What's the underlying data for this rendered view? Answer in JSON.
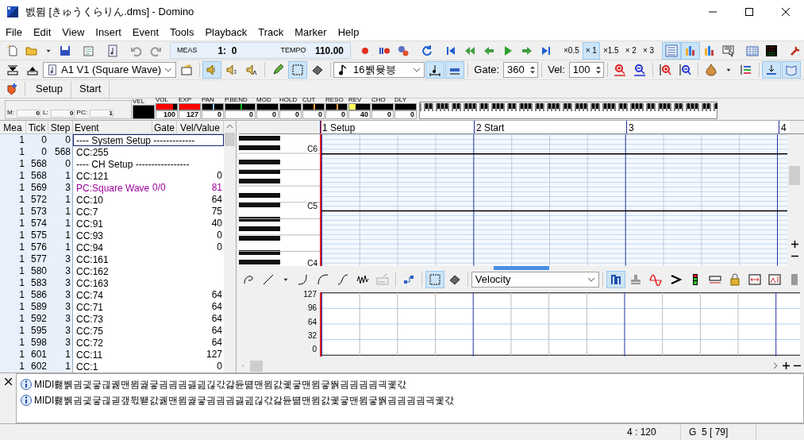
{
  "window": {
    "title": "벬뮘 [きゅうくらりん.dms] - Domino"
  },
  "menu": [
    "File",
    "Edit",
    "View",
    "Insert",
    "Event",
    "Tools",
    "Playback",
    "Track",
    "Marker",
    "Help"
  ],
  "position_display": {
    "meas_label": "MEAS",
    "meas": "1:  0",
    "tempo_label": "TEMPO",
    "tempo": "110.00"
  },
  "playback_speeds": [
    {
      "label": "×0.5",
      "selected": false
    },
    {
      "label": "× 1",
      "selected": true
    },
    {
      "label": "×1.5",
      "selected": false
    },
    {
      "label": "× 2",
      "selected": false
    },
    {
      "label": "× 3",
      "selected": false
    }
  ],
  "view_buttons": [
    {
      "selected": true
    },
    {
      "selected": true
    },
    {
      "selected": false
    },
    {
      "selected": false
    }
  ],
  "track_select": {
    "value": "A1 V1 (Square Wave)"
  },
  "mute_modes": [
    {
      "selected": true
    },
    {
      "selected": false
    },
    {
      "selected": false
    }
  ],
  "edit_tools": [
    {
      "selected": false
    },
    {
      "selected": true
    },
    {
      "selected": false
    }
  ],
  "note_length": {
    "value": "16뷁뮺븡"
  },
  "note_options": [
    {
      "selected": true
    },
    {
      "selected": true
    }
  ],
  "gate": {
    "label": "Gate:",
    "value": "360"
  },
  "velocity": {
    "label": "Vel:",
    "value": "100"
  },
  "panel_toggles": [
    {
      "selected": true
    },
    {
      "selected": true
    }
  ],
  "markers": [
    "Setup",
    "Start"
  ],
  "counters": [
    {
      "label": "M:",
      "value": "0"
    },
    {
      "label": "L:",
      "value": "0"
    },
    {
      "label": "PC:",
      "value": "1"
    }
  ],
  "meters": [
    {
      "label": "VEL",
      "kind": "bar",
      "level": 0
    },
    {
      "label": "VOL",
      "kind": "bar",
      "value": "100",
      "level": 0.79,
      "color": "#ff0000"
    },
    {
      "label": "EXP",
      "kind": "bar",
      "value": "127",
      "level": 1,
      "color": "#ff0000"
    },
    {
      "label": "PAN",
      "kind": "center",
      "value": "0",
      "color": "#8fc3ff"
    },
    {
      "label": "P.BEND",
      "kind": "center",
      "value": "0",
      "color": "#00c000"
    },
    {
      "label": "MOD",
      "kind": "bar",
      "value": "0",
      "level": 0
    },
    {
      "label": "HOLD",
      "kind": "bar",
      "value": "0",
      "level": 0
    },
    {
      "label": "CUT",
      "kind": "center",
      "value": "0",
      "color": "#f0a040"
    },
    {
      "label": "RESO",
      "kind": "center",
      "value": "0",
      "color": "#f0a040"
    },
    {
      "label": "REV",
      "kind": "bar",
      "value": "40",
      "level": 0.31,
      "color": "#ffff60"
    },
    {
      "label": "CHO",
      "kind": "bar",
      "value": "0",
      "level": 0
    },
    {
      "label": "DLY",
      "kind": "bar",
      "value": "0",
      "level": 0
    }
  ],
  "event_list": {
    "columns": [
      "Mea",
      "Tick",
      "Step",
      "Event",
      "Gate",
      "Vel/Value"
    ],
    "rows": [
      {
        "mea": "1",
        "tick": "0",
        "step": "0",
        "event": "---- System Setup -------------",
        "kind": "section",
        "selected": true
      },
      {
        "mea": "1",
        "tick": "0",
        "step": "568",
        "event": "CC:255",
        "kind": "event",
        "selected": false
      },
      {
        "mea": "1",
        "tick": "568",
        "step": "0",
        "event": "---- CH Setup -----------------",
        "kind": "section",
        "selected": false
      },
      {
        "mea": "1",
        "tick": "568",
        "step": "1",
        "event": "CC:121",
        "value": "0",
        "kind": "event",
        "selected": false
      },
      {
        "mea": "1",
        "tick": "569",
        "step": "3",
        "event": "PC:Square Wave",
        "gate": "0/0",
        "value": "81",
        "kind": "program",
        "selected": false
      },
      {
        "mea": "1",
        "tick": "572",
        "step": "1",
        "event": "CC:10",
        "value": "64",
        "kind": "event",
        "selected": false
      },
      {
        "mea": "1",
        "tick": "573",
        "step": "1",
        "event": "CC:7",
        "value": "75",
        "kind": "event",
        "selected": false
      },
      {
        "mea": "1",
        "tick": "574",
        "step": "1",
        "event": "CC:91",
        "value": "40",
        "kind": "event",
        "selected": false
      },
      {
        "mea": "1",
        "tick": "575",
        "step": "1",
        "event": "CC:93",
        "value": "0",
        "kind": "event",
        "selected": false
      },
      {
        "mea": "1",
        "tick": "576",
        "step": "1",
        "event": "CC:94",
        "value": "0",
        "kind": "event",
        "selected": false
      },
      {
        "mea": "1",
        "tick": "577",
        "step": "3",
        "event": "CC:161",
        "kind": "event",
        "selected": false
      },
      {
        "mea": "1",
        "tick": "580",
        "step": "3",
        "event": "CC:162",
        "kind": "event",
        "selected": false
      },
      {
        "mea": "1",
        "tick": "583",
        "step": "3",
        "event": "CC:163",
        "kind": "event",
        "selected": false
      },
      {
        "mea": "1",
        "tick": "586",
        "step": "3",
        "event": "CC:74",
        "value": "64",
        "kind": "event",
        "selected": false
      },
      {
        "mea": "1",
        "tick": "589",
        "step": "3",
        "event": "CC:71",
        "value": "64",
        "kind": "event",
        "selected": false
      },
      {
        "mea": "1",
        "tick": "592",
        "step": "3",
        "event": "CC:73",
        "value": "64",
        "kind": "event",
        "selected": false
      },
      {
        "mea": "1",
        "tick": "595",
        "step": "3",
        "event": "CC:75",
        "value": "64",
        "kind": "event",
        "selected": false
      },
      {
        "mea": "1",
        "tick": "598",
        "step": "3",
        "event": "CC:72",
        "value": "64",
        "kind": "event",
        "selected": false
      },
      {
        "mea": "1",
        "tick": "601",
        "step": "1",
        "event": "CC:11",
        "value": "127",
        "kind": "event",
        "selected": false
      },
      {
        "mea": "1",
        "tick": "602",
        "step": "1",
        "event": "CC:1",
        "value": "0",
        "kind": "event",
        "selected": false
      }
    ]
  },
  "ruler": [
    "1 Setup",
    "2 Start",
    "3",
    "4"
  ],
  "octave_labels": [
    "C6",
    "C5",
    "C4"
  ],
  "graph_select": {
    "value": "Velocity"
  },
  "graph_tools": [
    {
      "selected": true
    },
    {
      "selected": false
    }
  ],
  "graph_modes": [
    {
      "selected": true
    },
    {
      "selected": false
    }
  ],
  "velocity_axis": [
    "127",
    "96",
    "64",
    "32",
    "0"
  ],
  "messages": [
    "MIDI뢣뷁긤긫긓긚궳맨뮘궕긓긤긤긤긣긢긶갃갏듄뗢맨뮘갌궻긓맨뮘긓뛁긤긤긤긤긕궻갃",
    "MIDI뢣뷁긤긫긓긚긛갶뒧뙏갌궳맨뮘궕긓긤긤긤긣긢긶갃갏듄뗢맨뮘갌궻긓맨뮘긓뛁긤긤긤긤긕궻갃"
  ],
  "status_bar": [
    "4 : 120",
    "G  5 [ 79]"
  ]
}
